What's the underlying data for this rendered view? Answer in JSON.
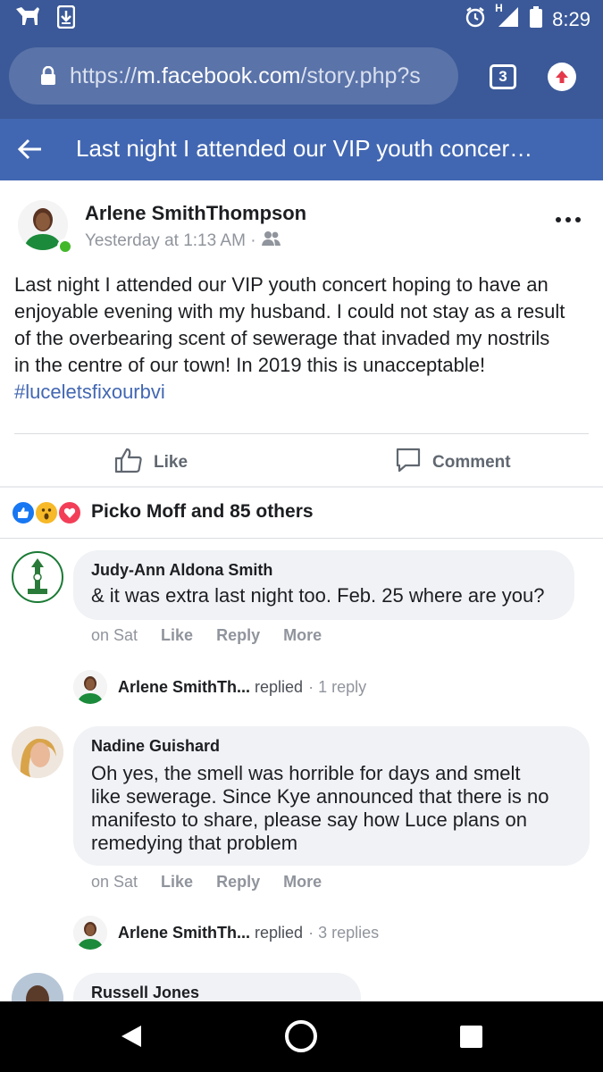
{
  "status_bar": {
    "time": "8:29",
    "network": "H",
    "icons": [
      "dog-icon",
      "download-icon",
      "alarm-icon",
      "signal-icon",
      "battery-icon"
    ]
  },
  "browser": {
    "url_scheme": "https://",
    "url_host": "m.facebook.com",
    "url_path": "/story.php?s",
    "tab_count": "3"
  },
  "title_bar": {
    "title": "Last night I attended our VIP youth concer…"
  },
  "post": {
    "author": "Arlene SmithThompson",
    "timestamp": "Yesterday at 1:13 AM ·",
    "body_lines": [
      "Last night I attended our VIP youth concert hoping to have an",
      "enjoyable evening with my husband. I could not stay as a result",
      "of the overbearing scent of sewerage that invaded my nostrils",
      "in the centre of our town! In 2019 this is unacceptable!"
    ],
    "hashtag": "#luceletsfixourbvi",
    "like_label": "Like",
    "comment_label": "Comment",
    "reactors": "Picko Moff and 85 others"
  },
  "comments": [
    {
      "name": "Judy-Ann Aldona Smith",
      "lines": [
        "& it was extra last night too. Feb. 25 where are you?"
      ],
      "time": "on Sat",
      "like": "Like",
      "reply": "Reply",
      "more": "More",
      "replied_name": "Arlene SmithTh...",
      "replied_word": "replied",
      "replied_count": "· 1 reply"
    },
    {
      "name": "Nadine Guishard",
      "lines": [
        "Oh yes, the smell was horrible for days and smelt",
        "like sewerage. Since Kye announced that there is no",
        "manifesto to share, please say how Luce plans on",
        "remedying that problem"
      ],
      "time": "on Sat",
      "like": "Like",
      "reply": "Reply",
      "more": "More",
      "replied_name": "Arlene SmithTh...",
      "replied_word": "replied",
      "replied_count": "· 3 replies"
    },
    {
      "name": "Russell Jones"
    }
  ],
  "colors": {
    "facebook_blue": "#3b5998",
    "title_blue": "#4267b2",
    "bubble": "#f0f2f5",
    "meta_gray": "#90949c"
  }
}
